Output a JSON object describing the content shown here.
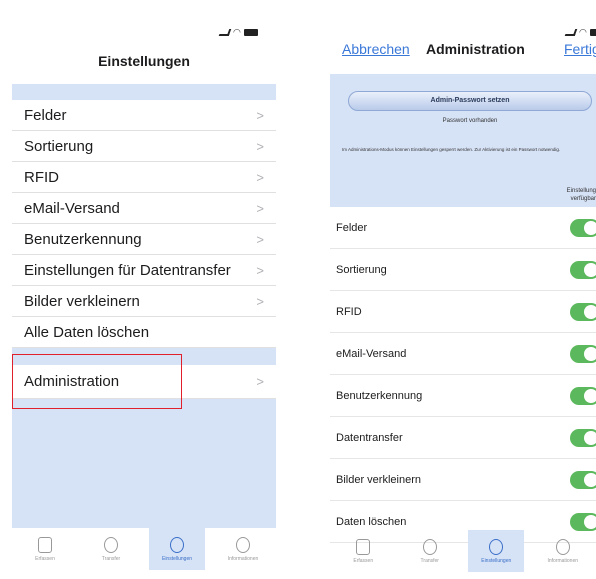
{
  "left": {
    "nav_title": "Einstellungen",
    "items": [
      {
        "label": "Felder"
      },
      {
        "label": "Sortierung"
      },
      {
        "label": "RFID"
      },
      {
        "label": "eMail-Versand"
      },
      {
        "label": "Benutzerkennung"
      },
      {
        "label": "Einstellungen für Datentransfer"
      },
      {
        "label": "Bilder verkleinern"
      },
      {
        "label": "Alle Daten löschen"
      }
    ],
    "admin_item": "Administration",
    "chevron": ">",
    "tabs": [
      {
        "label": "Erfassen",
        "icon": "clipboard-icon",
        "active": false
      },
      {
        "label": "Transfer",
        "icon": "sync-icon",
        "active": false
      },
      {
        "label": "Einstellungen",
        "icon": "gear-icon",
        "active": true
      },
      {
        "label": "Informationen",
        "icon": "info-icon",
        "active": false
      }
    ],
    "highlight_color": "#e0202a"
  },
  "right": {
    "cancel_label": "Abbrechen",
    "nav_title": "Administration",
    "done_label": "Fertig",
    "admin_password_button": "Admin-Passwort setzen",
    "password_state": "Passwort vorhanden",
    "info_text": "Im Administrations-Modus können Einstellungen gesperrt werden. Zur Aktivierung ist ein Passwort notwendig.",
    "available_header": "Einstellung verfügbar",
    "items": [
      {
        "label": "Felder",
        "enabled": true
      },
      {
        "label": "Sortierung",
        "enabled": true
      },
      {
        "label": "RFID",
        "enabled": true
      },
      {
        "label": "eMail-Versand",
        "enabled": true
      },
      {
        "label": "Benutzerkennung",
        "enabled": true
      },
      {
        "label": "Datentransfer",
        "enabled": true
      },
      {
        "label": "Bilder verkleinern",
        "enabled": true
      },
      {
        "label": "Daten löschen",
        "enabled": true
      }
    ],
    "tabs": [
      {
        "label": "Erfassen",
        "icon": "clipboard-icon",
        "active": false
      },
      {
        "label": "Transfer",
        "icon": "sync-icon",
        "active": false
      },
      {
        "label": "Einstellungen",
        "icon": "gear-icon",
        "active": true
      },
      {
        "label": "Informationen",
        "icon": "info-icon",
        "active": false
      }
    ],
    "toggle_color": "#5cb85c",
    "link_color": "#3a78d8"
  },
  "band_color": "#d6e2f6"
}
